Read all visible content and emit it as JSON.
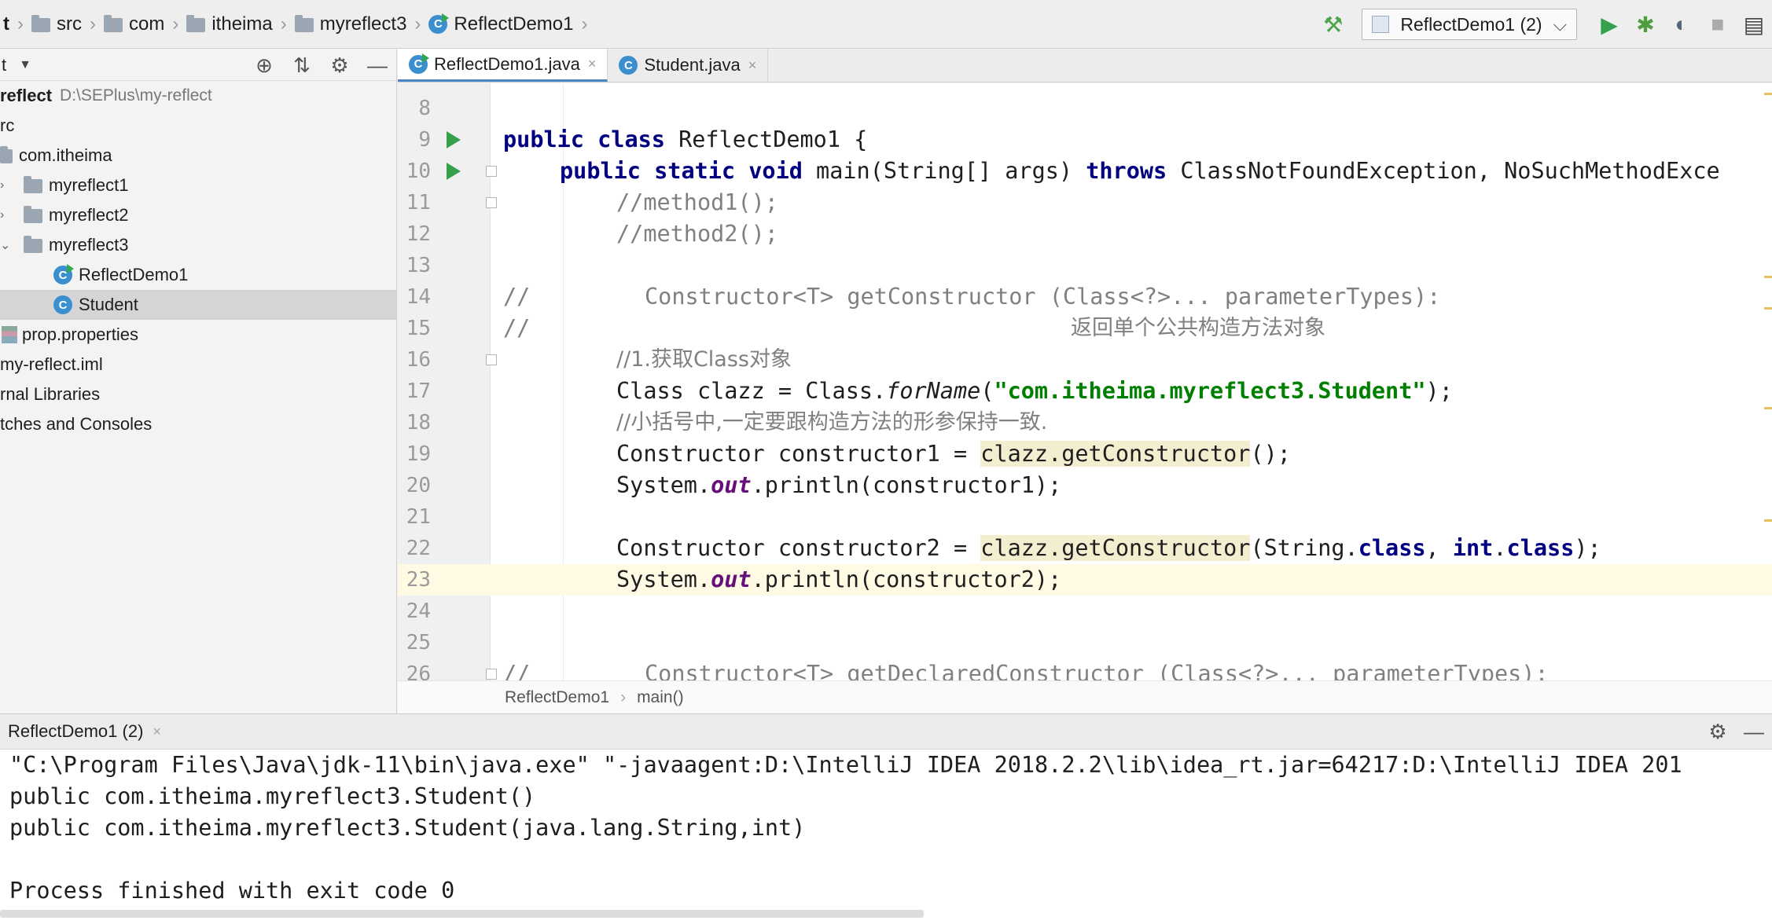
{
  "navbar": {
    "crumbs": [
      "t",
      "src",
      "com",
      "itheima",
      "myreflect3",
      "ReflectDemo1"
    ],
    "run_config": "ReflectDemo1 (2)",
    "icons": [
      "hammer-icon",
      "play-icon",
      "debug-icon",
      "coverage-icon",
      "stop-icon",
      "layout-icon"
    ]
  },
  "project": {
    "header": "t",
    "tree": [
      {
        "label": "reflect",
        "path": "D:\\SEPlus\\my-reflect",
        "bold": true
      },
      {
        "label": "rc"
      },
      {
        "label": "com.itheima"
      },
      {
        "label": "myreflect1"
      },
      {
        "label": "myreflect2"
      },
      {
        "label": "myreflect3"
      },
      {
        "label": "ReflectDemo1"
      },
      {
        "label": "Student"
      },
      {
        "label": "prop.properties"
      },
      {
        "label": "my-reflect.iml"
      },
      {
        "label": "rnal Libraries"
      },
      {
        "label": "tches and Consoles"
      }
    ]
  },
  "tabs": [
    {
      "label": "ReflectDemo1.java",
      "active": true
    },
    {
      "label": "Student.java",
      "active": false
    }
  ],
  "editor": {
    "line_numbers": [
      "8",
      "9",
      "10",
      "11",
      "12",
      "13",
      "14",
      "15",
      "16",
      "17",
      "18",
      "19",
      "20",
      "21",
      "22",
      "23",
      "24",
      "25",
      "26"
    ],
    "comments": {
      "l11": "//method1();",
      "l12": "//method2();",
      "l14a": "//",
      "l14b": "Constructor<T> getConstructor (Class<?>... parameterTypes):",
      "l15a": "//",
      "l15b": "返回单个公共构造方法对象",
      "l16": "//1.获取Class对象",
      "l18": "//小括号中,一定要跟构造方法的形参保持一致.",
      "l26a": "//",
      "l26b": "Constructor<T> getDeclaredConstructor (Class<?>... parameterTypes):"
    },
    "code": {
      "public": "public",
      "class": "class",
      "static": "static",
      "void": "void",
      "throws": "throws",
      "int": "int",
      "class_kw": "class",
      "classname": " ReflectDemo1 {",
      "main_sig": " main(String[] args) ",
      "exceptions": " ClassNotFoundException, NoSuchMethodExce",
      "l17_a": "Class clazz = Class.",
      "l17_forName": "forName",
      "l17_b": "(",
      "l17_str": "\"com.itheima.myreflect3.Student\"",
      "l17_c": ");",
      "l19_a": "Constructor constructor1 = ",
      "l19_hl": "clazz.getConstructor",
      "l19_b": "();",
      "l20_a": "System.",
      "l20_out": "out",
      "l20_b": ".println(constructor1);",
      "l22_a": "Constructor constructor2 = ",
      "l22_hl": "clazz.getConstructor",
      "l22_b": "(String.",
      "l22_c": ", ",
      "l22_d": ".",
      "l22_e": ");",
      "l23_b": ".println(constructor2);"
    }
  },
  "editor_breadcrumb": [
    "ReflectDemo1",
    "main()"
  ],
  "run_panel": {
    "tab": "ReflectDemo1 (2)",
    "console": [
      "\"C:\\Program Files\\Java\\jdk-11\\bin\\java.exe\" \"-javaagent:D:\\IntelliJ IDEA 2018.2.2\\lib\\idea_rt.jar=64217:D:\\IntelliJ IDEA 201",
      "public com.itheima.myreflect3.Student()",
      "public com.itheima.myreflect3.Student(java.lang.String,int)",
      "",
      "Process finished with exit code 0"
    ]
  },
  "colors": {
    "keyword": "#000080",
    "string": "#008000",
    "comment": "#808080",
    "static_field": "#660e7a",
    "run_green": "#35a14c",
    "current_line": "#fffae3"
  }
}
